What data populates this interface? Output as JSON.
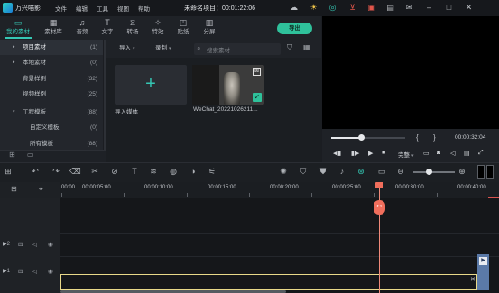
{
  "titlebar": {
    "app_name": "万兴喵影",
    "menus": [
      "文件",
      "编辑",
      "工具",
      "视图",
      "帮助"
    ],
    "project_title": "未命名项目：00:01:22:06"
  },
  "tabs": [
    {
      "label": "我的素材",
      "icon": "folder-icon",
      "active": true
    },
    {
      "label": "素材库",
      "icon": "library-icon"
    },
    {
      "label": "音频",
      "icon": "music-icon"
    },
    {
      "label": "文字",
      "icon": "text-icon"
    },
    {
      "label": "转场",
      "icon": "transition-icon"
    },
    {
      "label": "特效",
      "icon": "effects-icon"
    },
    {
      "label": "贴纸",
      "icon": "sticker-icon"
    },
    {
      "label": "分屏",
      "icon": "split-screen-icon"
    }
  ],
  "export_label": "导出",
  "sidebar": {
    "items": [
      {
        "label": "项目素材",
        "count": "(1)",
        "arrow": "▸",
        "selected": true
      },
      {
        "label": "本地素材",
        "count": "(0)",
        "arrow": "▸"
      },
      {
        "label": "背景样例",
        "count": "(32)",
        "arrow": ""
      },
      {
        "label": "视频样例",
        "count": "(25)",
        "arrow": ""
      },
      {
        "label": "工程模板",
        "count": "(88)",
        "arrow": "▾"
      },
      {
        "label": "自定义模板",
        "count": "(0)",
        "arrow": ""
      },
      {
        "label": "所有模板",
        "count": "(88)",
        "arrow": ""
      }
    ]
  },
  "library": {
    "import_dropdown": "导入",
    "record_dropdown": "录制",
    "search_placeholder": "搜索素材",
    "import_tile_label": "导入媒体",
    "video_label": "WeChat_20221026211..."
  },
  "preview": {
    "time": "00:00:32:04",
    "quality": "完整",
    "progress": 0.41
  },
  "timeline": {
    "ticks": [
      "00:00",
      "00:00:05:00",
      "00:00:10:00",
      "00:00:15:00",
      "00:00:20:00",
      "00:00:25:00",
      "00:00:30:00",
      "00:00:35:00",
      "00:00:40:00"
    ],
    "tracks": [
      {
        "label": "▶2"
      },
      {
        "label": "▶1"
      }
    ]
  }
}
